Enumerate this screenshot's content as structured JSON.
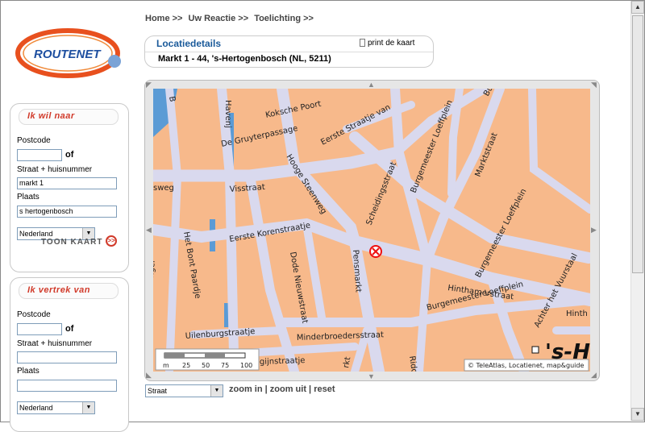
{
  "breadcrumb": [
    "Home >>",
    "Uw Reactie >>",
    "Toelichting >>"
  ],
  "logo_text": "ROUTENET",
  "panel_to": {
    "title": "Ik wil naar",
    "postcode_label": "Postcode",
    "of_label": "of",
    "street_label": "Straat + huisnummer",
    "street_value": "markt 1",
    "city_label": "Plaats",
    "city_value": "s hertogenbosch",
    "country_value": "Nederland",
    "show_map_label": "TOON KAART",
    "go_icon": ">>"
  },
  "panel_from": {
    "title": "Ik vertrek van",
    "postcode_label": "Postcode",
    "of_label": "of",
    "street_label": "Straat + huisnummer",
    "city_label": "Plaats",
    "country_value": "Nederland"
  },
  "location": {
    "title": "Locatiedetails",
    "print_label": "print de kaart",
    "address": "Markt 1 - 44, 's-Hertogenbosch (NL, 5211)"
  },
  "map": {
    "streets": [
      "Koksche Poort",
      "De Gruyterpassage",
      "Eerste Straatje van",
      "Havenj",
      "Hooge Steenweg",
      "Visstraat",
      "sweg",
      "Scheidingsstraat",
      "Burgemeester Loeffplein",
      "Burgemeester Loeffplein",
      "Marktstraat",
      "Eerste Korenstraatje",
      "Het Bont Paardje",
      "Dode Nieuwstraat",
      "Pensmarkt",
      "Burgemeester Loeffplein",
      "Hinthamerstraat",
      "Achter het Vuurstaal",
      "Hinth",
      "Uilenburgstraatje",
      "Minderbroedersstraat",
      "gijnstraatje",
      "Ridde",
      "rkt",
      "ngel",
      "Bu",
      "B"
    ],
    "city_label": "'s-H",
    "scale_labels": [
      "m",
      "25",
      "50",
      "75",
      "100"
    ],
    "copyright": "© TeleAtlas, Locatienet, map&guide",
    "colors": {
      "block": "#f7b98b",
      "road": "#d9d9ee",
      "water": "#5b9bd5"
    }
  },
  "map_type_value": "Straat",
  "zoom_links": {
    "zoom_in": "zoom in",
    "sep1": " | ",
    "zoom_out": "zoom uit",
    "sep2": " | ",
    "reset": "reset"
  }
}
